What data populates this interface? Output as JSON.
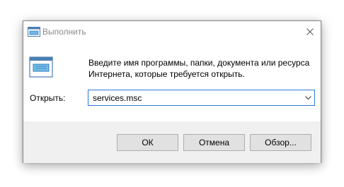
{
  "window": {
    "title": "Выполнить",
    "close_icon": "close-icon",
    "app_icon": "run-icon"
  },
  "content": {
    "description": "Введите имя программы, папки, документа или ресурса Интернета, которые требуется открыть.",
    "open_label": "Открыть:",
    "command_value": "services.msc",
    "dropdown_icon": "chevron-down-icon"
  },
  "buttons": {
    "ok": "ОК",
    "cancel": "Отмена",
    "browse": "Обзор..."
  },
  "colors": {
    "focus_border": "#2b79d7",
    "footer_bg": "#f0f0f0",
    "button_bg": "#e1e1e1"
  }
}
